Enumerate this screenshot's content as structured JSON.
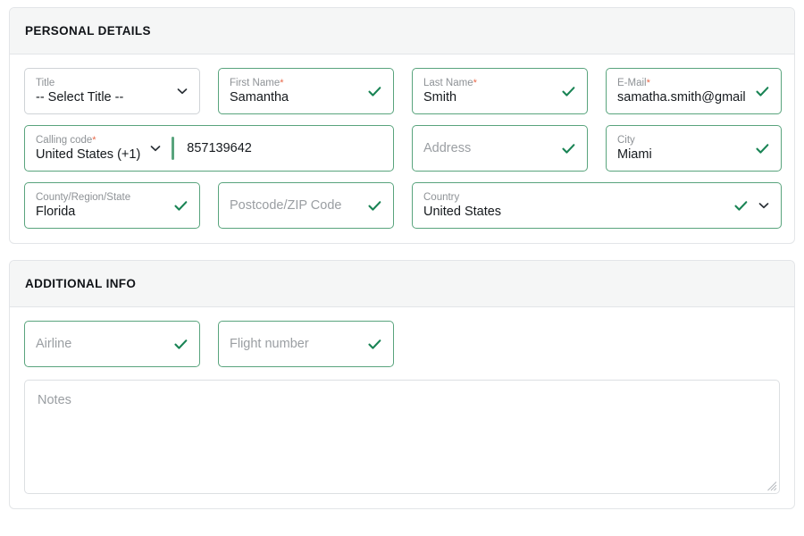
{
  "colors": {
    "valid_border": "#59a47d",
    "check": "#1a8455",
    "required_asterisk": "#e8694a",
    "label_gray": "#8e9296",
    "placeholder_gray": "#9a9ea2",
    "card_border": "#e3e5e8",
    "header_bg": "#f5f6f6",
    "text": "#15191d"
  },
  "personal_details": {
    "title": "PERSONAL DETAILS",
    "fields": {
      "title_select": {
        "label": "Title",
        "value": "-- Select Title --",
        "required": false,
        "icon": "chevron-down-icon"
      },
      "first_name": {
        "label": "First Name",
        "required_mark": "*",
        "value": "Samantha",
        "icon": "check-icon"
      },
      "last_name": {
        "label": "Last Name",
        "required_mark": "*",
        "value": "Smith",
        "icon": "check-icon"
      },
      "email": {
        "label": "E-Mail",
        "required_mark": "*",
        "value": "samatha.smith@gmail",
        "icon": "check-icon"
      },
      "calling_code": {
        "label": "Calling code",
        "required_mark": "*",
        "value": "United States (+1)",
        "icon": "chevron-down-icon"
      },
      "phone_number": {
        "value": "857139642"
      },
      "address": {
        "label": "Address",
        "placeholder": "Address",
        "value": "",
        "icon": "check-icon"
      },
      "city": {
        "label": "City",
        "value": "Miami",
        "icon": "check-icon"
      },
      "county_region_state": {
        "label": "County/Region/State",
        "value": "Florida",
        "icon": "check-icon"
      },
      "postcode": {
        "label": "Postcode/ZIP Code",
        "placeholder": "Postcode/ZIP Code",
        "value": "",
        "icon": "check-icon"
      },
      "country": {
        "label": "Country",
        "value": "United States",
        "icon": "check-icon",
        "icon2": "chevron-down-icon"
      }
    }
  },
  "additional_info": {
    "title": "ADDITIONAL INFO",
    "fields": {
      "airline": {
        "label": "Airline",
        "placeholder": "Airline",
        "value": "",
        "icon": "check-icon"
      },
      "flight_number": {
        "label": "Flight number",
        "placeholder": "Flight number",
        "value": "",
        "icon": "check-icon"
      },
      "notes": {
        "label": "Notes",
        "placeholder": "Notes",
        "value": ""
      }
    }
  }
}
